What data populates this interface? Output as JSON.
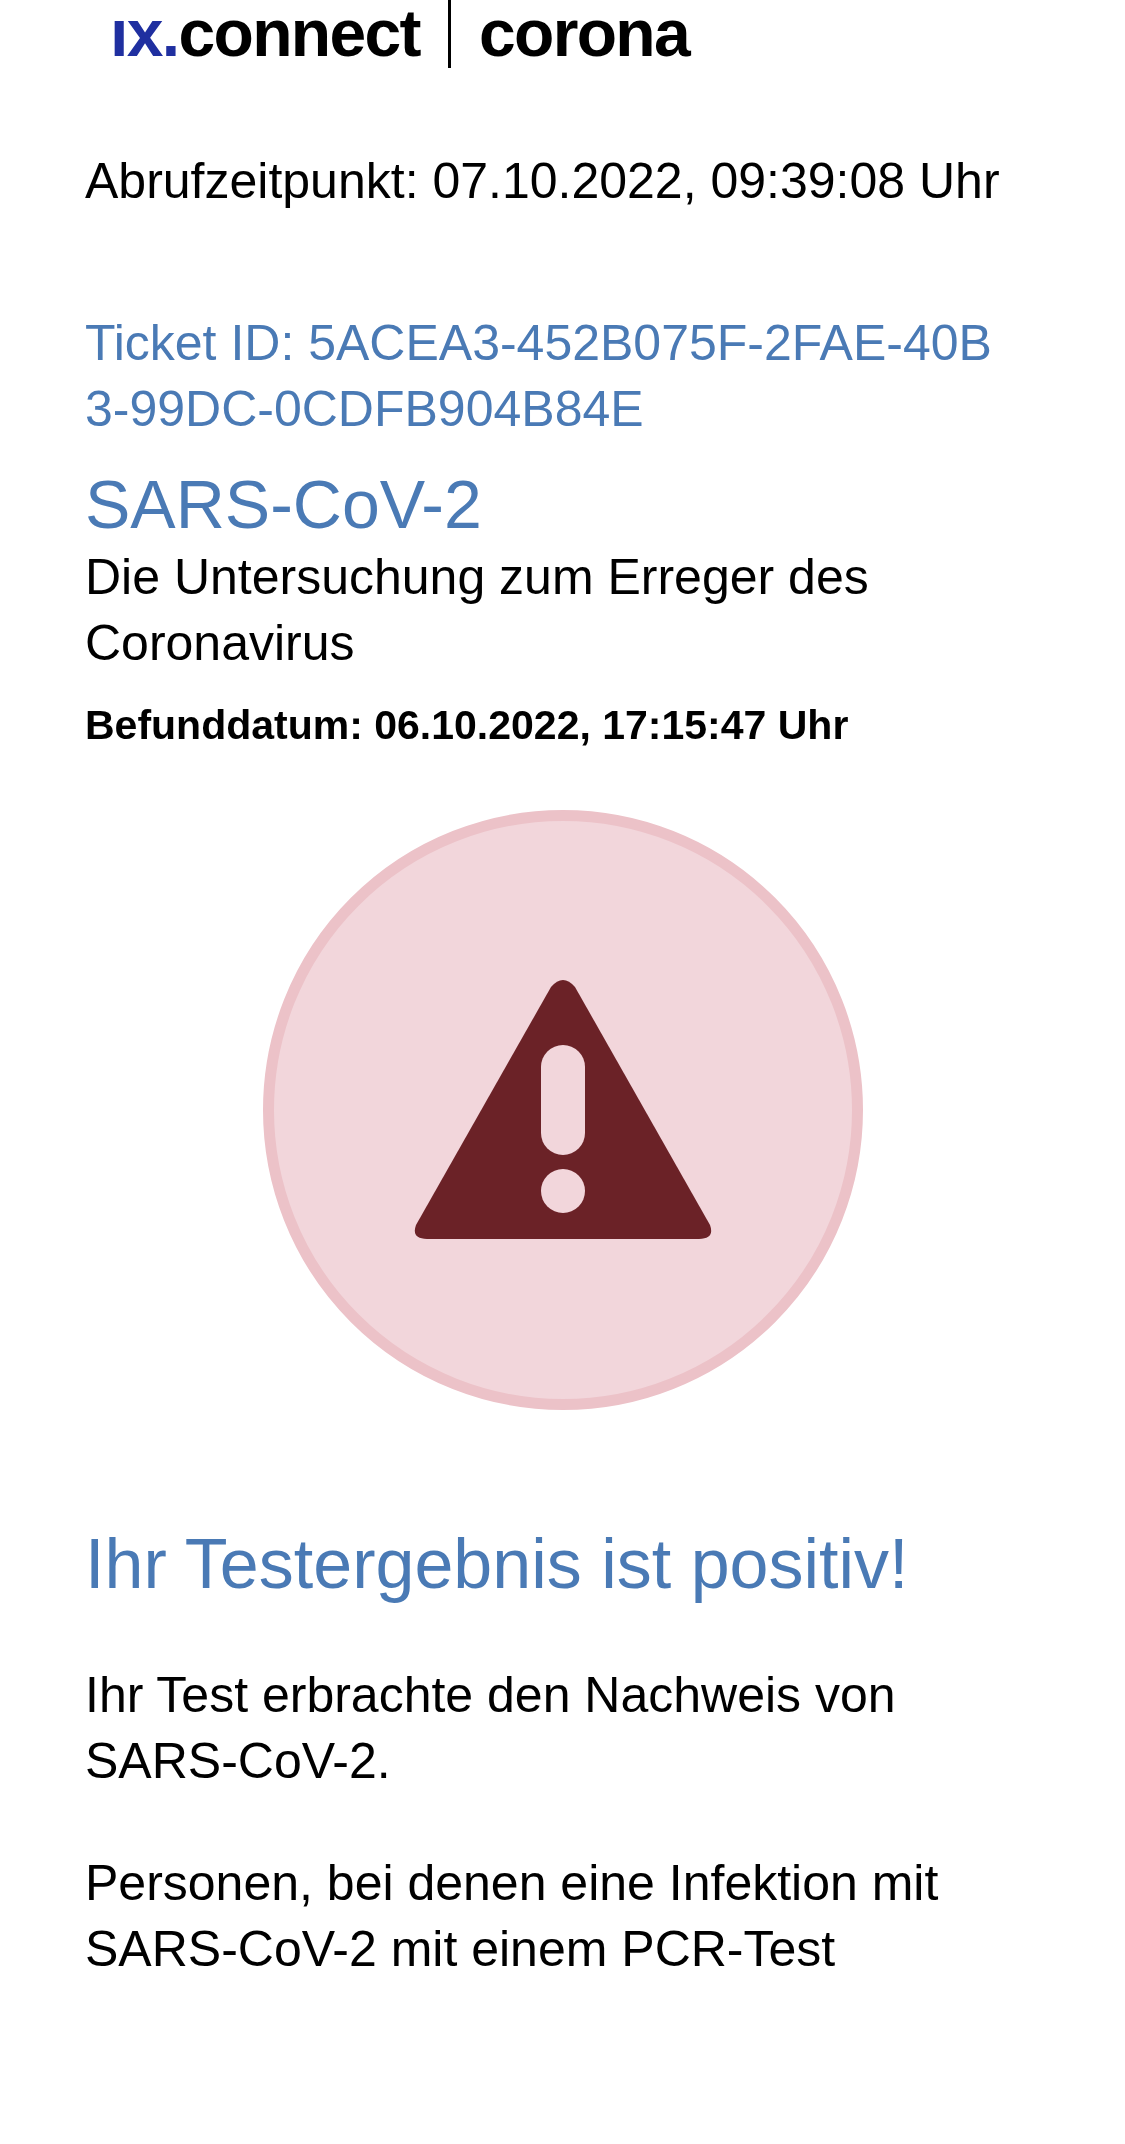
{
  "logo": {
    "brand": "ıx.",
    "product": "connect",
    "section": "corona"
  },
  "retrieval_time": "Abrufzeitpunkt: 07.10.2022, 09:39:08 Uhr",
  "ticket_id": "Ticket ID: 5ACEA3-452B075F-2FAE-40B3-99DC-0CDFB904B84E",
  "test": {
    "title": "SARS-CoV-2",
    "subtitle": "Die Untersuchung zum Erreger des Coronavirus",
    "result_date": "Befunddatum: 06.10.2022, 17:15:47 Uhr"
  },
  "result": {
    "kind": "warning",
    "heading": "Ihr Testergebnis ist positiv!"
  },
  "paragraphs": [
    "Ihr Test erbrachte den Nachweis von SARS-CoV-2.",
    "Personen, bei denen eine Infektion mit SARS-CoV-2 mit einem PCR-Test"
  ]
}
